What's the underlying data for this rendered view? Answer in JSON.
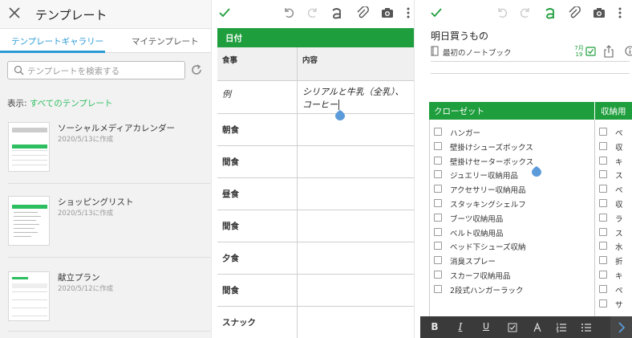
{
  "panel1": {
    "title": "テンプレート",
    "tabs": [
      "テンプレートギャラリー",
      "マイテンプレート"
    ],
    "search_placeholder": "テンプレートを検索する",
    "filter_label": "表示:",
    "filter_value": "すべてのテンプレート",
    "templates": [
      {
        "name": "ソーシャルメディアカレンダー",
        "date": "2020/5/13に作成"
      },
      {
        "name": "ショッピングリスト",
        "date": "2020/5/13に作成"
      },
      {
        "name": "献立プラン",
        "date": "2020/5/12に作成"
      }
    ]
  },
  "panel2": {
    "table_header": "日付",
    "col1": "食事",
    "col2": "内容",
    "example_label": "例",
    "example_line1": "シリアルと牛乳（全乳）、",
    "example_line2": "コーヒー",
    "meals": [
      "朝食",
      "間食",
      "昼食",
      "間食",
      "夕食",
      "間食",
      "スナック"
    ]
  },
  "panel3": {
    "note_title": "明日買うもの",
    "notebook": "最初のノートブック",
    "reminder_month": "7月",
    "reminder_day": "19",
    "col1_header": "クローゼット",
    "col2_header": "収納用",
    "items": [
      "ハンガー",
      "壁掛けシューズボックス",
      "壁掛けセーターボックス",
      "ジュエリー収納用品",
      "アクセサリー収納用品",
      "スタッキングシェルフ",
      "ブーツ収納用品",
      "ベルト収納用品",
      "ベッド下シューズ収納",
      "消臭スプレー",
      "スカーフ収納用品",
      "2段式ハンガーラック"
    ],
    "items2": [
      "ペ",
      "収",
      "キ",
      "ス",
      "ペ",
      "収",
      "ラ",
      "ス",
      "水",
      "折",
      "キ",
      "ペ",
      "サ"
    ],
    "format_buttons": [
      "B",
      "I",
      "U"
    ]
  },
  "colors": {
    "accent_green": "#1f9e3d",
    "accent_blue": "#2a9ad6",
    "toolbar_dark": "#3a3a3a"
  }
}
